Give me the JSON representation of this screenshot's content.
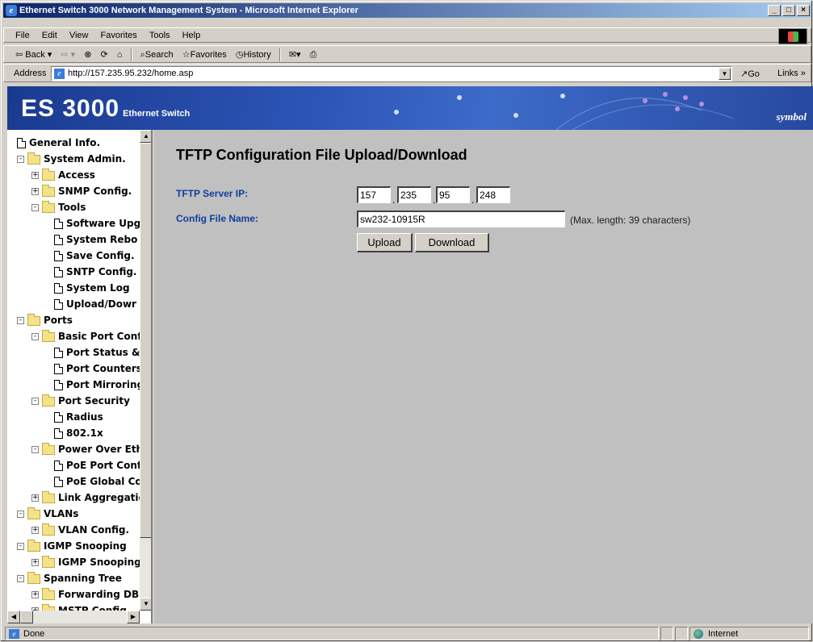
{
  "window": {
    "title": "Ethernet Switch 3000 Network Management System - Microsoft Internet Explorer",
    "min_label": "_",
    "max_label": "□",
    "close_label": "×"
  },
  "menu": [
    "File",
    "Edit",
    "View",
    "Favorites",
    "Tools",
    "Help"
  ],
  "toolbar": {
    "back": "Back",
    "search": "Search",
    "favorites": "Favorites",
    "history": "History"
  },
  "address": {
    "label": "Address",
    "url": "http://157.235.95.232/home.asp",
    "go": "Go",
    "links": "Links"
  },
  "banner": {
    "product": "ES 3000",
    "subtitle": "Ethernet Switch",
    "vendor": "symbol"
  },
  "tree": [
    {
      "label": "General Info.",
      "type": "doc",
      "level": 0
    },
    {
      "label": "System Admin.",
      "type": "folder",
      "level": 0,
      "expander": "-"
    },
    {
      "label": "Access",
      "type": "folder",
      "level": 1,
      "expander": "+"
    },
    {
      "label": "SNMP Config.",
      "type": "folder",
      "level": 1,
      "expander": "+"
    },
    {
      "label": "Tools",
      "type": "folder",
      "level": 1,
      "expander": "-"
    },
    {
      "label": "Software Upg",
      "type": "doc",
      "level": 2
    },
    {
      "label": "System Rebo",
      "type": "doc",
      "level": 2
    },
    {
      "label": "Save Config.",
      "type": "doc",
      "level": 2
    },
    {
      "label": "SNTP Config.",
      "type": "doc",
      "level": 2
    },
    {
      "label": "System Log",
      "type": "doc",
      "level": 2
    },
    {
      "label": "Upload/Dowr",
      "type": "doc",
      "level": 2
    },
    {
      "label": "Ports",
      "type": "folder",
      "level": 0,
      "expander": "-"
    },
    {
      "label": "Basic Port Confi",
      "type": "folder",
      "level": 1,
      "expander": "-"
    },
    {
      "label": "Port Status &",
      "type": "doc",
      "level": 2
    },
    {
      "label": "Port Counters",
      "type": "doc",
      "level": 2
    },
    {
      "label": "Port Mirroring",
      "type": "doc",
      "level": 2
    },
    {
      "label": "Port Security",
      "type": "folder",
      "level": 1,
      "expander": "-"
    },
    {
      "label": "Radius",
      "type": "doc",
      "level": 2
    },
    {
      "label": "802.1x",
      "type": "doc",
      "level": 2
    },
    {
      "label": "Power Over Eth",
      "type": "folder",
      "level": 1,
      "expander": "-"
    },
    {
      "label": "PoE Port Conf",
      "type": "doc",
      "level": 2
    },
    {
      "label": "PoE Global Co",
      "type": "doc",
      "level": 2
    },
    {
      "label": "Link Aggregatio",
      "type": "folder",
      "level": 1,
      "expander": "+"
    },
    {
      "label": "VLANs",
      "type": "folder",
      "level": 0,
      "expander": "-"
    },
    {
      "label": "VLAN Config.",
      "type": "folder",
      "level": 1,
      "expander": "+"
    },
    {
      "label": "IGMP Snooping",
      "type": "folder",
      "level": 0,
      "expander": "-"
    },
    {
      "label": "IGMP Snooping",
      "type": "folder",
      "level": 1,
      "expander": "+"
    },
    {
      "label": "Spanning Tree",
      "type": "folder",
      "level": 0,
      "expander": "-"
    },
    {
      "label": "Forwarding DB",
      "type": "folder",
      "level": 1,
      "expander": "+"
    },
    {
      "label": "MSTP Config",
      "type": "folder",
      "level": 1,
      "expander": "+"
    }
  ],
  "page": {
    "title": "TFTP Configuration File Upload/Download",
    "server_ip_label": "TFTP Server IP:",
    "ip": [
      "157",
      "235",
      "95",
      "248"
    ],
    "file_label": "Config File Name:",
    "file_value": "sw232-10915R",
    "file_note": "(Max. length: 39 characters)",
    "upload_label": "Upload",
    "download_label": "Download"
  },
  "status": {
    "text": "Done",
    "zone": "Internet"
  }
}
